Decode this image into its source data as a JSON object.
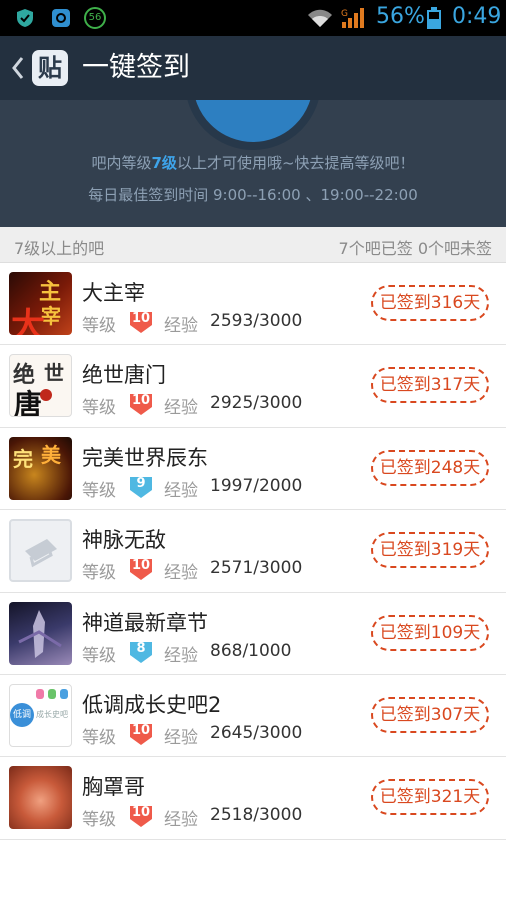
{
  "status": {
    "battery_percent": "56%",
    "time": "0:49",
    "notif_badge": "56"
  },
  "header": {
    "title": "一键签到",
    "logo": "贴"
  },
  "banner": {
    "line1_pre": "吧内等级",
    "line1_level": "7级",
    "line1_post": "以上才可使用哦~快去提高等级吧！",
    "line2": "每日最佳签到时间  9:00--16:00 、19:00--22:00"
  },
  "section": {
    "left": "7级以上的吧",
    "right": "7个吧已签 0个吧未签"
  },
  "labels": {
    "level": "等级",
    "exp": "经验"
  },
  "bars": [
    {
      "name": "大主宰",
      "level": "10",
      "exp": "2593/3000",
      "status": "已签到316天",
      "badge_color": "#ef5a4a"
    },
    {
      "name": "绝世唐门",
      "level": "10",
      "exp": "2925/3000",
      "status": "已签到317天",
      "badge_color": "#ef5a4a"
    },
    {
      "name": "完美世界辰东",
      "level": "9",
      "exp": "1997/2000",
      "status": "已签到248天",
      "badge_color": "#4fb8e2"
    },
    {
      "name": "神脉无敌",
      "level": "10",
      "exp": "2571/3000",
      "status": "已签到319天",
      "badge_color": "#ef5a4a"
    },
    {
      "name": "神道最新章节",
      "level": "8",
      "exp": "868/1000",
      "status": "已签到109天",
      "badge_color": "#4fb8e2"
    },
    {
      "name": "低调成长史吧2",
      "level": "10",
      "exp": "2645/3000",
      "status": "已签到307天",
      "badge_color": "#ef5a4a"
    },
    {
      "name": "胸罩哥",
      "level": "10",
      "exp": "2518/3000",
      "status": "已签到321天",
      "badge_color": "#ef5a4a"
    }
  ],
  "avatars": {
    "a0": "主",
    "a0b": "宰",
    "a0c": "大",
    "a1": "绝",
    "a1b": "世",
    "a1c": "唐",
    "a2": "完",
    "a2b": "美",
    "a5": "低调",
    "a5b": "成长史吧"
  },
  "colors": {
    "accent_red": "#d9481f",
    "header_bg": "#23303f",
    "banner_bg": "#33404f",
    "highlight_blue": "#3ea4ea"
  }
}
